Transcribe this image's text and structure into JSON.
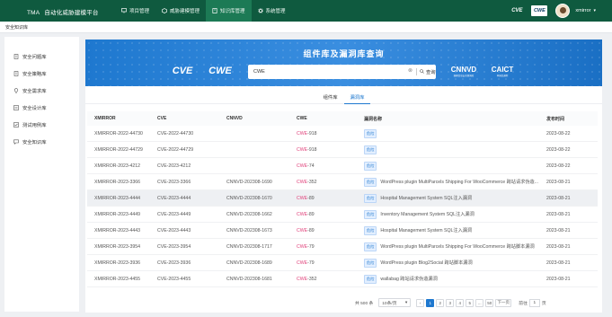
{
  "header": {
    "brand": "TMA",
    "subtitle": "自动化威胁建模平台",
    "nav": [
      {
        "label": "项目管理",
        "icon": "monitor-icon"
      },
      {
        "label": "威胁建模管理",
        "icon": "cube-icon"
      },
      {
        "label": "知识库管理",
        "icon": "book-icon"
      },
      {
        "label": "系统管理",
        "icon": "gear-icon"
      }
    ],
    "active_nav": "知识库管理",
    "logo_cve": "CVE",
    "logo_cwe": "CWE",
    "username": "xmirror"
  },
  "breadcrumb": "安全知识库",
  "sidebar": {
    "items": [
      {
        "label": "安全问题库",
        "icon": "doc-icon"
      },
      {
        "label": "安全策略库",
        "icon": "doc-icon"
      },
      {
        "label": "安全需求库",
        "icon": "bulb-icon"
      },
      {
        "label": "安全设计库",
        "icon": "list-icon"
      },
      {
        "label": "测试用例库",
        "icon": "checklist-icon"
      },
      {
        "label": "安全知识库",
        "icon": "chat-icon"
      }
    ]
  },
  "banner": {
    "title": "组件库及漏洞库查询",
    "search_value": "CWE",
    "search_button": "查询",
    "logos": {
      "cve": "CVE",
      "cwe": "CWE",
      "cnnvd": "CNNVD",
      "cnnvd_sub": "国家信息安全漏洞库",
      "caict": "CAICT",
      "caict_sub": "中国信通院"
    }
  },
  "tabs": [
    {
      "label": "组件库",
      "active": false
    },
    {
      "label": "漏洞库",
      "active": true
    }
  ],
  "table": {
    "headers": [
      "XMIRROR",
      "CVE",
      "CNNVD",
      "CWE",
      "漏洞名称",
      "发布时间"
    ],
    "badge": "危险",
    "rows": [
      {
        "xmirror": "XMIRROR-2022-44730",
        "cve": "CVE-2022-44730",
        "cnnvd": "",
        "cwe_prefix": "CWE",
        "cwe_suffix": "-918",
        "name": "",
        "date": "2023-08-22"
      },
      {
        "xmirror": "XMIRROR-2022-44729",
        "cve": "CVE-2022-44729",
        "cnnvd": "",
        "cwe_prefix": "CWE",
        "cwe_suffix": "-918",
        "name": "",
        "date": "2023-08-22"
      },
      {
        "xmirror": "XMIRROR-2023-4212",
        "cve": "CVE-2023-4212",
        "cnnvd": "",
        "cwe_prefix": "CWE",
        "cwe_suffix": "-74",
        "name": "",
        "date": "2023-08-22"
      },
      {
        "xmirror": "XMIRROR-2023-3366",
        "cve": "CVE-2023-3366",
        "cnnvd": "CNNVD-202308-1690",
        "cwe_prefix": "CWE",
        "cwe_suffix": "-352",
        "name": "WordPress plugin MultiParcels Shipping For WooCommerce 跨站请求伪造...",
        "date": "2023-08-21"
      },
      {
        "xmirror": "XMIRROR-2023-4444",
        "cve": "CVE-2023-4444",
        "cnnvd": "CNNVD-202308-1670",
        "cwe_prefix": "CWE",
        "cwe_suffix": "-89",
        "name": "Hospital Management System SQL注入漏洞",
        "date": "2023-08-21"
      },
      {
        "xmirror": "XMIRROR-2023-4449",
        "cve": "CVE-2023-4449",
        "cnnvd": "CNNVD-202308-1662",
        "cwe_prefix": "CWE",
        "cwe_suffix": "-89",
        "name": "Inventory Management System SQL注入漏洞",
        "date": "2023-08-21"
      },
      {
        "xmirror": "XMIRROR-2023-4443",
        "cve": "CVE-2023-4443",
        "cnnvd": "CNNVD-202308-1673",
        "cwe_prefix": "CWE",
        "cwe_suffix": "-89",
        "name": "Hospital Management System SQL注入漏洞",
        "date": "2023-08-21"
      },
      {
        "xmirror": "XMIRROR-2023-3954",
        "cve": "CVE-2023-3954",
        "cnnvd": "CNNVD-202308-1717",
        "cwe_prefix": "CWE",
        "cwe_suffix": "-79",
        "name": "WordPress plugin MultiParcels Shipping For WooCommerce 跨站脚本漏洞",
        "date": "2023-08-21"
      },
      {
        "xmirror": "XMIRROR-2023-3936",
        "cve": "CVE-2023-3936",
        "cnnvd": "CNNVD-202308-1689",
        "cwe_prefix": "CWE",
        "cwe_suffix": "-79",
        "name": "WordPress plugin Blog2Social 跨站脚本漏洞",
        "date": "2023-08-21"
      },
      {
        "xmirror": "XMIRROR-2023-4455",
        "cve": "CVE-2023-4455",
        "cnnvd": "CNNVD-202308-1681",
        "cwe_prefix": "CWE",
        "cwe_suffix": "-352",
        "name": "wallabag 跨站请求伪造漏洞",
        "date": "2023-08-21"
      }
    ]
  },
  "pagination": {
    "total": "共 500 条",
    "page_size": "10条/页",
    "prev": "‹",
    "pages": [
      "1",
      "2",
      "3",
      "4",
      "5",
      "...",
      "50"
    ],
    "current": "1",
    "next": "下一页",
    "goto_label": "前往",
    "goto_value": "1",
    "goto_suffix": "页"
  },
  "colors": {
    "topbar": "#0f5a3f",
    "accent": "#1e78cf",
    "cwe_link": "#e0417a"
  }
}
